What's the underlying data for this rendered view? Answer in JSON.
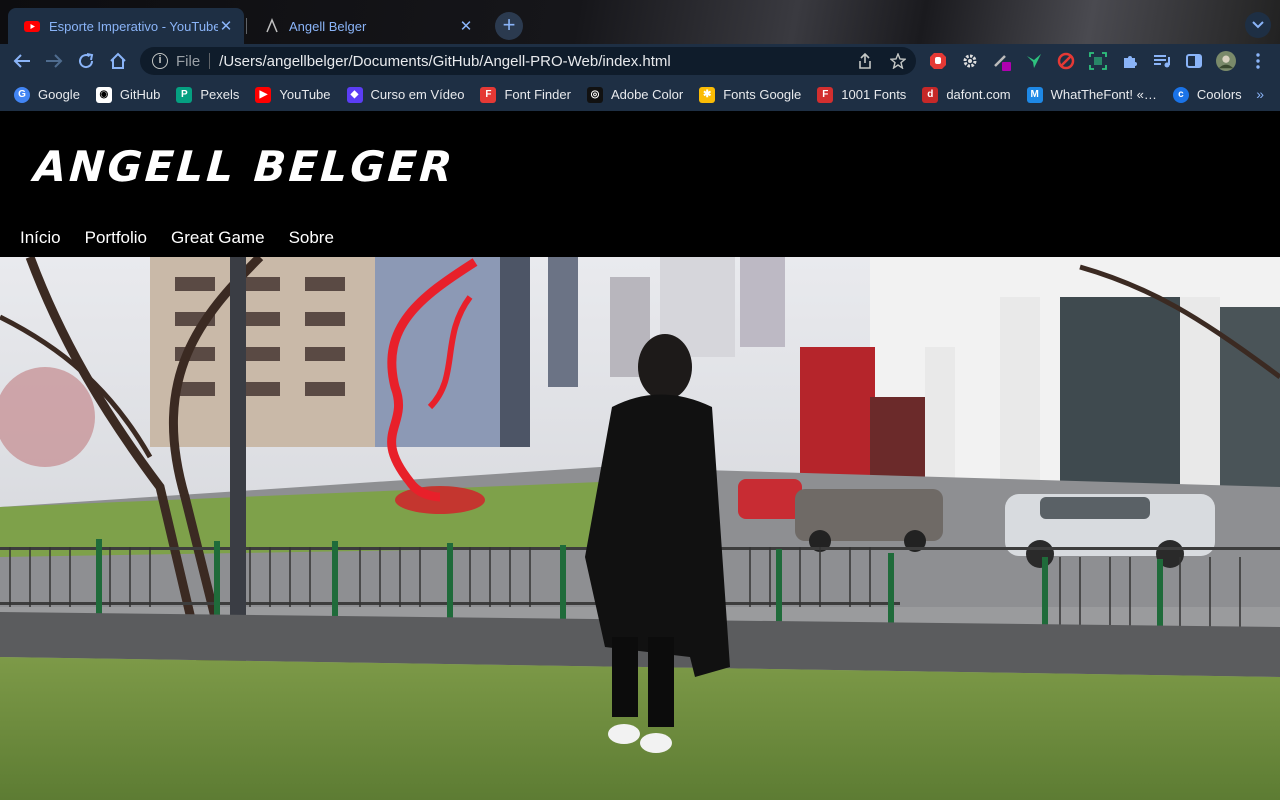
{
  "tabs": [
    {
      "title": "Esporte Imperativo - YouTube",
      "active": true
    },
    {
      "title": "Angell Belger",
      "active": false
    }
  ],
  "address_bar": {
    "scheme": "File",
    "url": "/Users/angellbelger/Documents/GitHub/Angell-PRO-Web/index.html"
  },
  "bookmarks": [
    {
      "label": "Google",
      "icon": "google-icon",
      "color": "#4285f4"
    },
    {
      "label": "GitHub",
      "icon": "github-icon",
      "color": "#ffffff"
    },
    {
      "label": "Pexels",
      "icon": "pexels-icon",
      "color": "#05a081"
    },
    {
      "label": "YouTube",
      "icon": "youtube-icon",
      "color": "#ff0000"
    },
    {
      "label": "Curso em Vídeo",
      "icon": "curso-em-video-icon",
      "color": "#5b3df5"
    },
    {
      "label": "Font Finder",
      "icon": "font-finder-icon",
      "color": "#e53935"
    },
    {
      "label": "Adobe Color",
      "icon": "adobe-color-icon",
      "color": "#111111"
    },
    {
      "label": "Fonts Google",
      "icon": "fonts-google-icon",
      "color": "#fbbc05"
    },
    {
      "label": "1001 Fonts",
      "icon": "1001-fonts-icon",
      "color": "#d32f2f"
    },
    {
      "label": "dafont.com",
      "icon": "dafont-icon",
      "color": "#c62828"
    },
    {
      "label": "WhatTheFont! «…",
      "icon": "whatthefont-icon",
      "color": "#1e88e5"
    },
    {
      "label": "Coolors",
      "icon": "coolors-icon",
      "color": "#1a73e8"
    }
  ],
  "site": {
    "logo": "ANGELL BELGER",
    "nav": [
      "Início",
      "Portfolio",
      "Great Game",
      "Sobre"
    ]
  },
  "colors": {
    "accent": "#8ab4f8",
    "chrome": "#1e2f44",
    "page_bg": "#000000"
  }
}
